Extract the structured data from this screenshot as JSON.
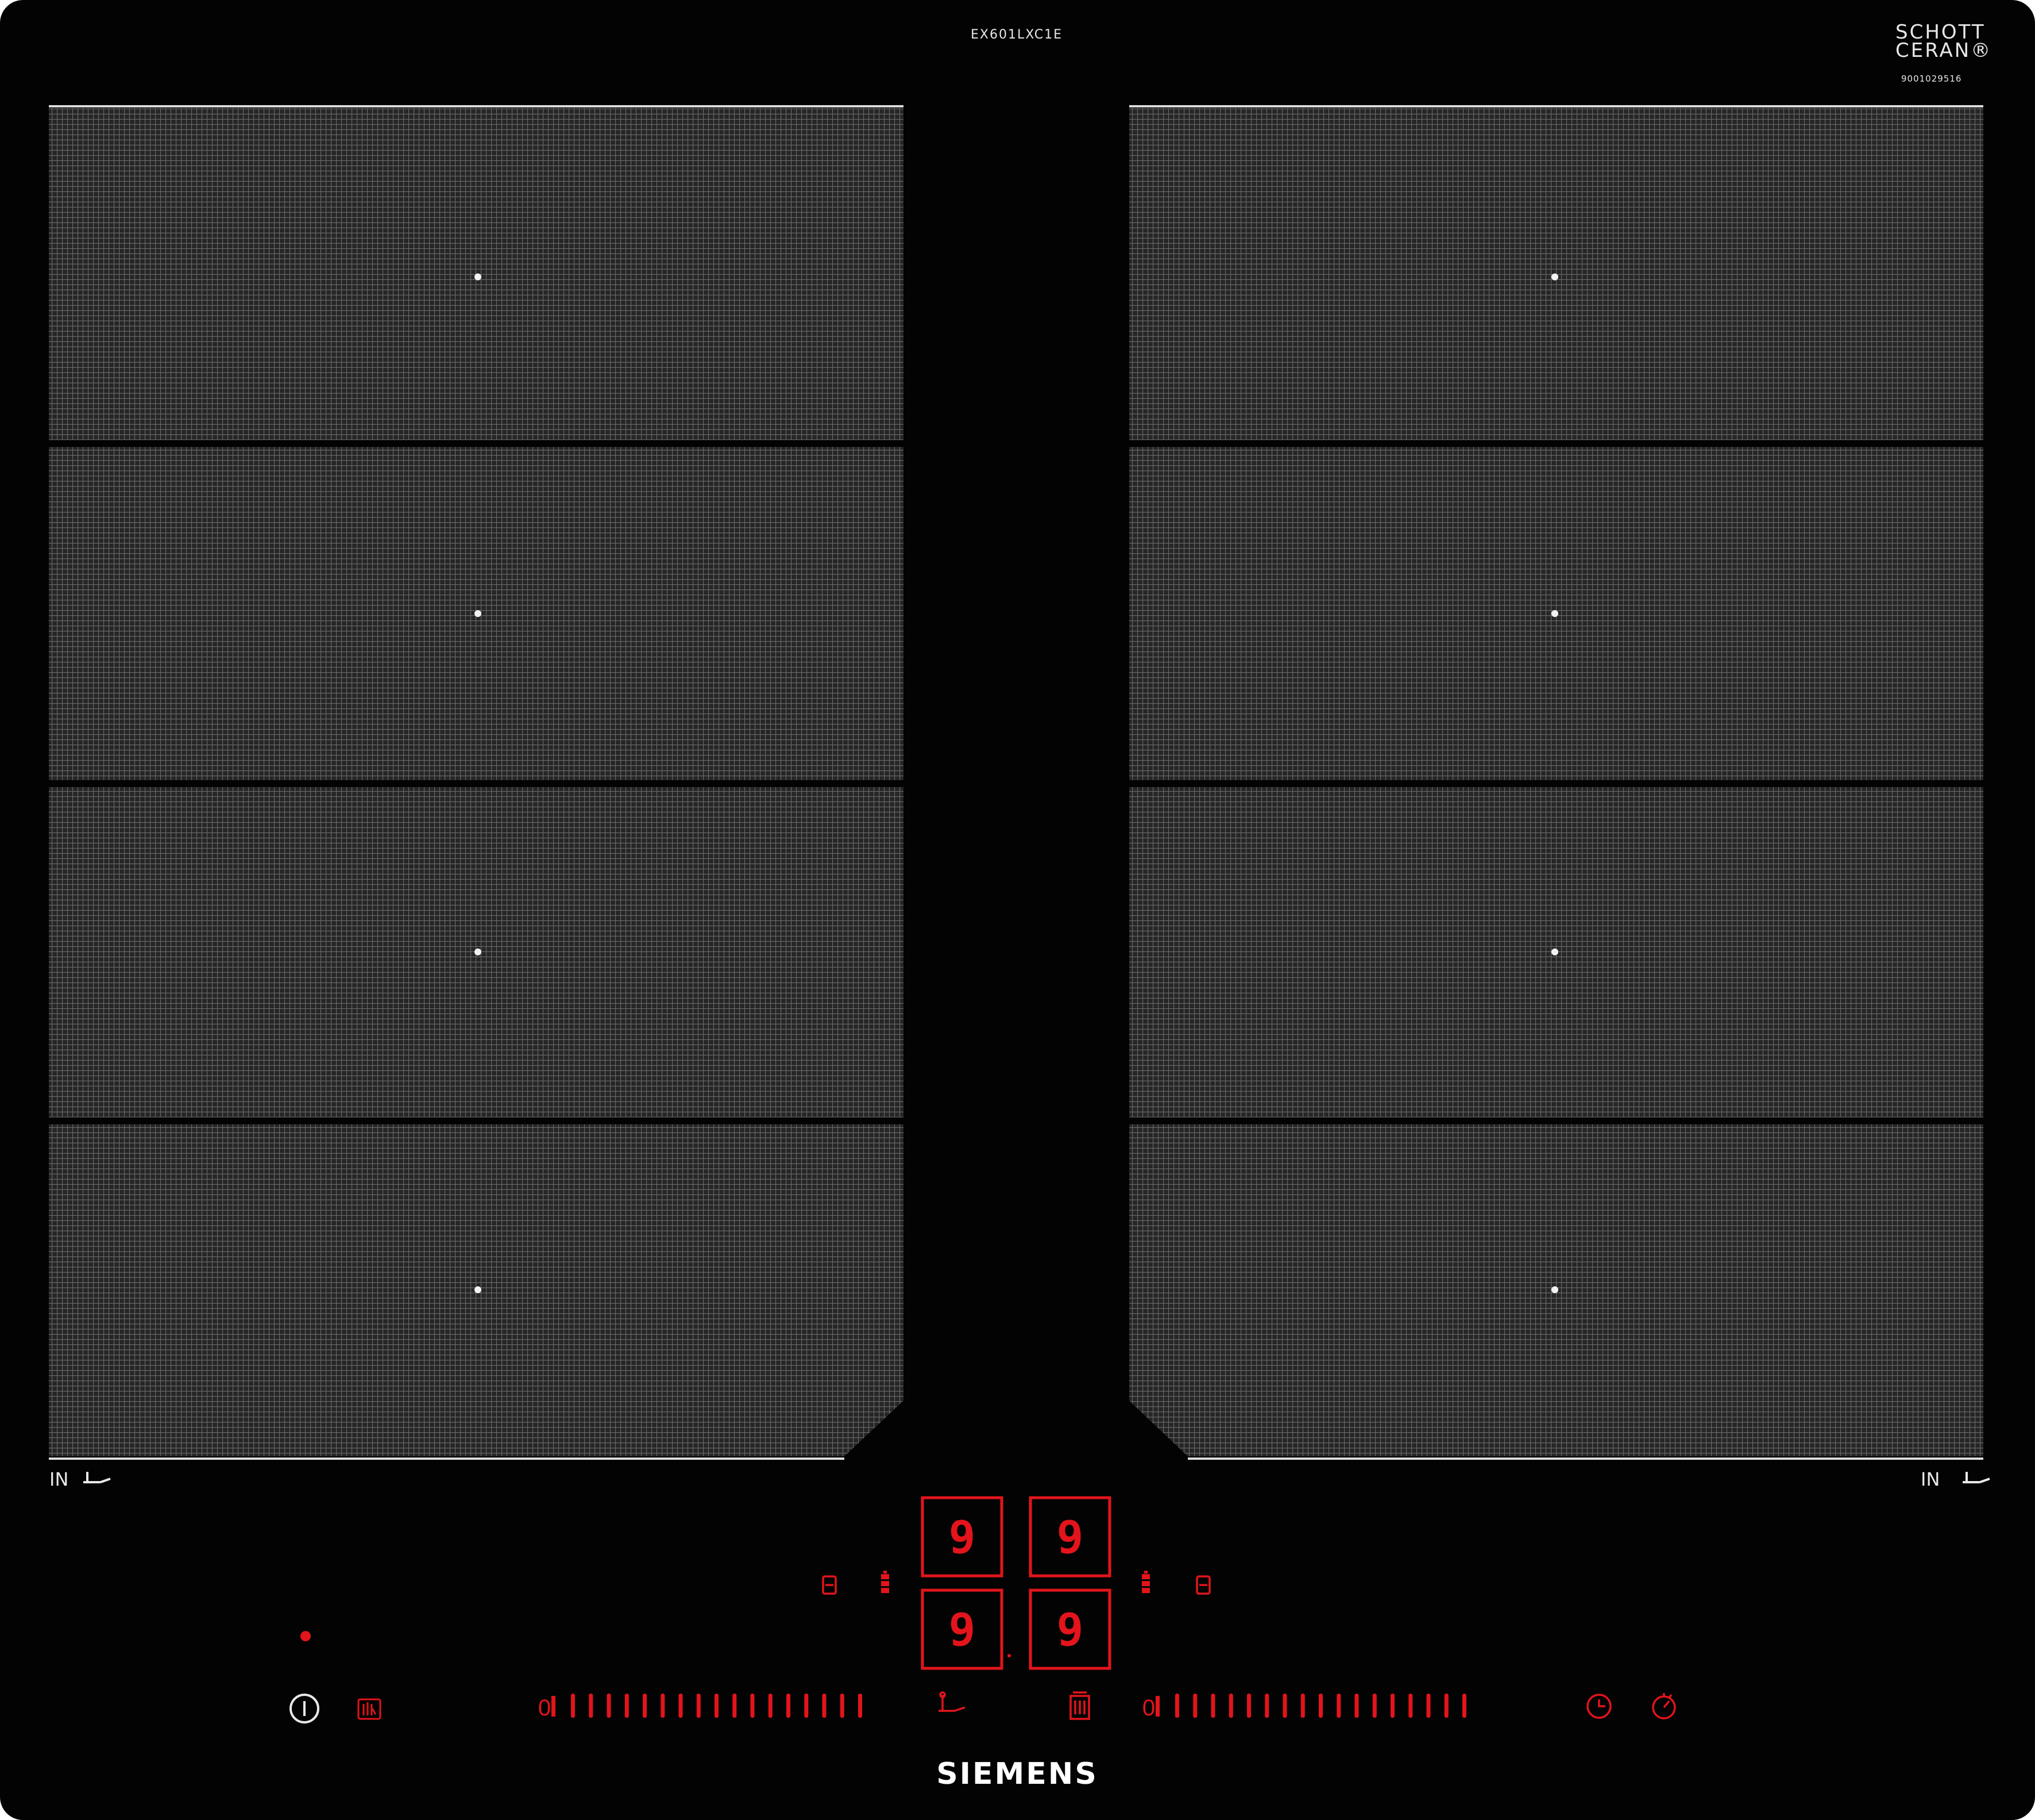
{
  "hob": {
    "model": "EX601LXC1E",
    "glass_brand_line1": "SCHOTT",
    "glass_brand_line2": "CERAN®",
    "serial": "9001029516",
    "brand": "SIEMENS",
    "zone_label": "IN",
    "zone_count_per_side": 4
  },
  "displays": [
    "9",
    "9",
    "9",
    "9"
  ],
  "sliders": {
    "left": {
      "zero_label": "0",
      "segments": 17
    },
    "right": {
      "zero_label": "0",
      "segments": 17
    }
  },
  "icons": {
    "power": "power-icon",
    "childlock": "childlock-icon",
    "flex_left": "flex-zone-icon",
    "sensor_left": "sensor-icon",
    "sensor_right": "sensor-icon",
    "flex_right": "flex-zone-icon",
    "frying": "frying-sensor-icon",
    "wipe": "wipe-protection-icon",
    "timer": "clock-icon",
    "stopwatch": "stopwatch-icon"
  },
  "colors": {
    "glass": "#030303",
    "zone_fill": "#2b2b2b",
    "zone_grid": "#6b6b6b",
    "control_red": "#e3141b",
    "text_white": "#e8e8e8"
  }
}
